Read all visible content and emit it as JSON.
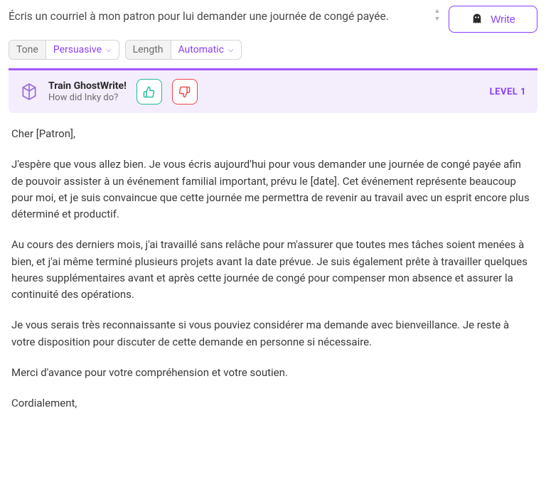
{
  "prompt": {
    "text": "Écris un courriel à mon patron pour lui demander une journée de congé payée."
  },
  "writeButton": {
    "label": "Write"
  },
  "controls": {
    "tone": {
      "label": "Tone",
      "value": "Persuasive"
    },
    "length": {
      "label": "Length",
      "value": "Automatic"
    }
  },
  "feedback": {
    "title": "Train GhostWrite!",
    "subtitle": "How did Inky do?",
    "level": "LEVEL 1"
  },
  "email": {
    "greeting": "Cher [Patron],",
    "p1": "J'espère que vous allez bien. Je vous écris aujourd'hui pour vous demander une journée de congé payée afin de pouvoir assister à un événement familial important, prévu le [date]. Cet événement représente beaucoup pour moi, et je suis convaincue que cette journée me permettra de revenir au travail avec un esprit encore plus déterminé et productif.",
    "p2": "Au cours des derniers mois, j'ai travaillé sans relâche pour m'assurer que toutes mes tâches soient menées à bien, et j'ai même terminé plusieurs projets avant la date prévue. Je suis également prête à travailler quelques heures supplémentaires avant et après cette journée de congé pour compenser mon absence et assurer la continuité des opérations.",
    "p3": "Je vous serais très reconnaissante si vous pouviez considérer ma demande avec bienveillance. Je reste à votre disposition pour discuter de cette demande en personne si nécessaire.",
    "p4": "Merci d'avance pour votre compréhension et votre soutien.",
    "closing": "Cordialement,"
  }
}
